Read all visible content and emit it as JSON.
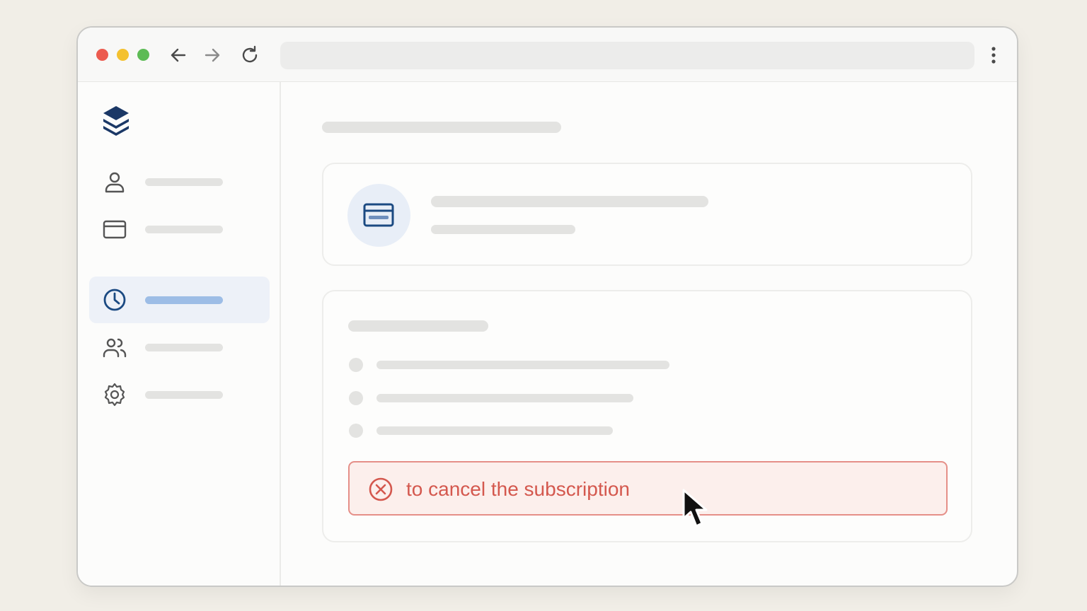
{
  "browser": {
    "traffic_lights": [
      "close",
      "minimize",
      "maximize"
    ],
    "nav": {
      "back_icon": "arrow-left-icon",
      "forward_icon": "arrow-right-icon",
      "reload_icon": "reload-icon",
      "menu_icon": "kebab-menu-icon"
    },
    "url": ""
  },
  "sidebar": {
    "logo_icon": "stacked-layers-logo",
    "items": [
      {
        "icon": "user-icon",
        "active": false
      },
      {
        "icon": "credit-card-icon",
        "active": false
      },
      {
        "icon": "clock-icon",
        "active": true
      },
      {
        "icon": "users-icon",
        "active": false
      },
      {
        "icon": "gear-icon",
        "active": false
      }
    ]
  },
  "main": {
    "payment_card": {
      "icon": "credit-card-icon"
    },
    "details_card": {
      "alert": {
        "icon": "circle-x-icon",
        "text": "to cancel the subscription"
      }
    }
  },
  "colors": {
    "accent": "#1b4a82",
    "active_bg": "#edf1f8",
    "alert_bg": "#fcefec",
    "alert_border": "#e58f88",
    "alert_text": "#d4584e"
  }
}
